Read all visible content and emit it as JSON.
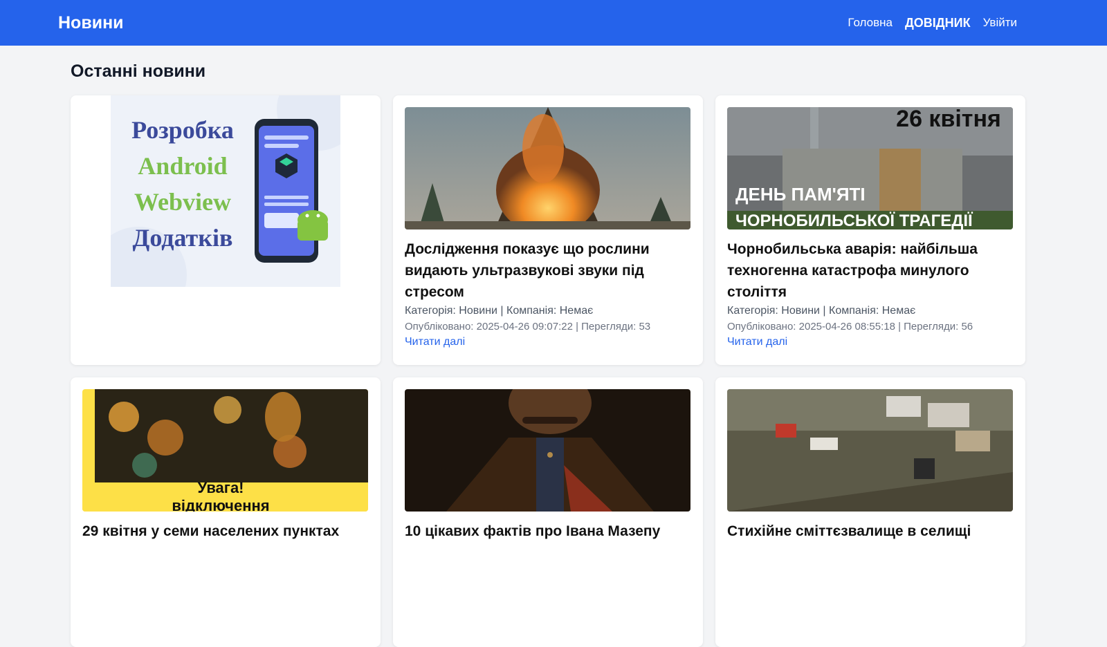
{
  "nav": {
    "brand": "Новини",
    "links": [
      {
        "label": "Головна"
      },
      {
        "label": "ДОВІДНИК"
      },
      {
        "label": "Увійти"
      }
    ]
  },
  "main": {
    "heading": "Останні новини",
    "promo": {
      "lines": [
        "Розробка",
        "Android",
        "Webview",
        "Додатків"
      ]
    },
    "cards": [
      {
        "title": "Дослідження показує що рослини видають ультразвукові звуки під стресом",
        "category_line": "Категорія: Новини | Компанія: Немає",
        "published_line": "Опубліковано: 2025-04-26 09:07:22 | Перегляди: 53",
        "read_more": "Читати далі"
      },
      {
        "title": "Чорнобильська аварія: найбільша техногенна катастрофа минулого століття",
        "category_line": "Категорія: Новини | Компанія: Немає",
        "published_line": "Опубліковано: 2025-04-26 08:55:18 | Перегляди: 56",
        "read_more": "Читати далі",
        "image_text_top": "26 квітня",
        "image_text_bottom_1": "ДЕНЬ ПАМ'ЯТІ",
        "image_text_bottom_2": "ЧОРНОБИЛЬСЬКОЇ ТРАГЕДІЇ"
      },
      {
        "title": "29 квітня у семи населених пунктах",
        "image_text_1": "Увага!",
        "image_text_2": "відключення"
      },
      {
        "title": "10 цікавих фактів про Івана Мазепу"
      },
      {
        "title": "Стихійне сміттєзвалище в селищі"
      }
    ]
  }
}
